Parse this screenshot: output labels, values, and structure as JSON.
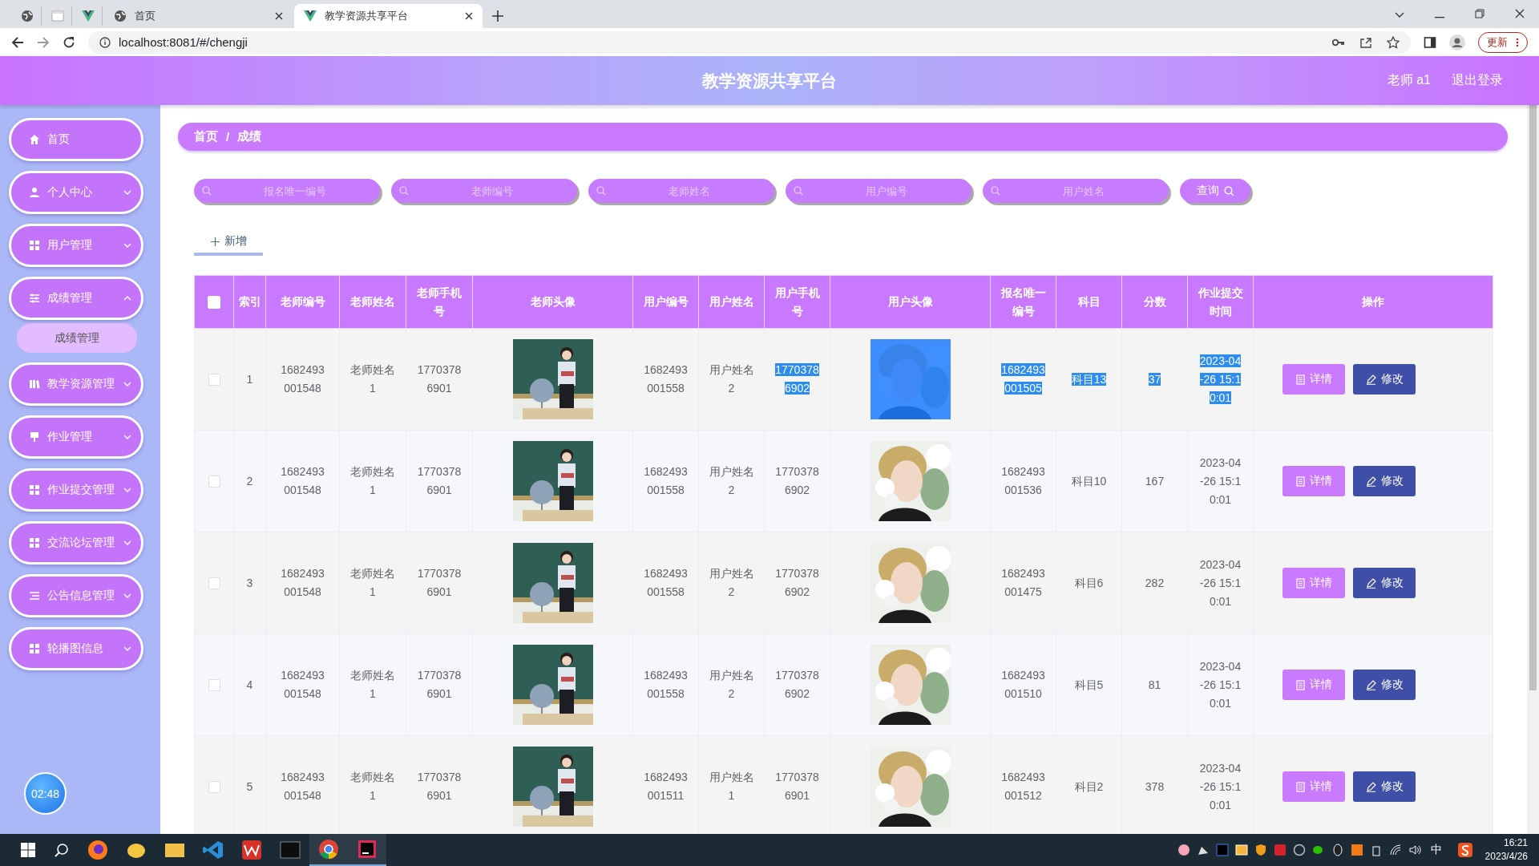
{
  "browser": {
    "tabs": [
      {
        "kind": "pinned"
      },
      {
        "kind": "pinned"
      },
      {
        "kind": "pinned"
      },
      {
        "kind": "page",
        "label": "首页",
        "selected": false
      },
      {
        "kind": "page",
        "label": "教学资源共享平台",
        "selected": true
      }
    ],
    "address": "localhost:8081/#/chengji",
    "update_button": "更新"
  },
  "header": {
    "title": "教学资源共享平台",
    "user": "老师 a1",
    "logout": "退出登录"
  },
  "sidebar": {
    "items": [
      {
        "kind": "link",
        "label": "首页"
      },
      {
        "kind": "menu",
        "label": "个人中心",
        "expanded": false
      },
      {
        "kind": "menu",
        "label": "用户管理",
        "expanded": false
      },
      {
        "kind": "menu",
        "label": "成绩管理",
        "expanded": true,
        "children": [
          {
            "label": "成绩管理",
            "selected": true
          }
        ]
      },
      {
        "kind": "menu",
        "label": "教学资源管理",
        "expanded": false
      },
      {
        "kind": "menu",
        "label": "作业管理",
        "expanded": false
      },
      {
        "kind": "menu",
        "label": "作业提交管理",
        "expanded": false
      },
      {
        "kind": "menu",
        "label": "交流论坛管理",
        "expanded": false
      },
      {
        "kind": "menu",
        "label": "公告信息管理",
        "expanded": false
      },
      {
        "kind": "menu",
        "label": "轮播图信息",
        "expanded": false
      }
    ],
    "clock": "02:48"
  },
  "breadcrumb": {
    "items": [
      "首页",
      "成绩"
    ],
    "separator": "/"
  },
  "search": {
    "fields": [
      {
        "placeholder": "报名唯一编号"
      },
      {
        "placeholder": "老师编号"
      },
      {
        "placeholder": "老师姓名"
      },
      {
        "placeholder": "用户编号"
      },
      {
        "placeholder": "用户姓名"
      }
    ],
    "button": "查询"
  },
  "add_tab": {
    "label": "新增",
    "selected": true
  },
  "table": {
    "header_checked": false,
    "columns": [
      "索引",
      "老师编号",
      "老师姓名",
      "老师手机号",
      "老师头像",
      "用户编号",
      "用户姓名",
      "用户手机号",
      "用户头像",
      "报名唯一编号",
      "科目",
      "分数",
      "作业提交时间",
      "操作"
    ],
    "rows": [
      {
        "checked": false,
        "text_selected": true,
        "cells": [
          "1",
          "1682493001548",
          "老师姓名1",
          "17703786901",
          {
            "kind": "picture"
          },
          "1682493001558",
          "用户姓名2",
          "17703786902",
          {
            "kind": "picture"
          },
          "1682493001505",
          "科目13",
          "37",
          "2023-04-26 15:10:01"
        ],
        "actions": [
          {
            "kind": "detail",
            "label": "详情"
          },
          {
            "kind": "edit",
            "label": "修改"
          }
        ]
      },
      {
        "checked": false,
        "text_selected": false,
        "cells": [
          "2",
          "1682493001548",
          "老师姓名1",
          "17703786901",
          {
            "kind": "picture"
          },
          "1682493001558",
          "用户姓名2",
          "17703786902",
          {
            "kind": "picture"
          },
          "1682493001536",
          "科目10",
          "167",
          "2023-04-26 15:10:01"
        ],
        "actions": [
          {
            "kind": "detail",
            "label": "详情"
          },
          {
            "kind": "edit",
            "label": "修改"
          }
        ]
      },
      {
        "checked": false,
        "text_selected": false,
        "cells": [
          "3",
          "1682493001548",
          "老师姓名1",
          "17703786901",
          {
            "kind": "picture"
          },
          "1682493001558",
          "用户姓名2",
          "17703786902",
          {
            "kind": "picture"
          },
          "1682493001475",
          "科目6",
          "282",
          "2023-04-26 15:10:01"
        ],
        "actions": [
          {
            "kind": "detail",
            "label": "详情"
          },
          {
            "kind": "edit",
            "label": "修改"
          }
        ]
      },
      {
        "checked": false,
        "text_selected": false,
        "cells": [
          "4",
          "1682493001548",
          "老师姓名1",
          "17703786901",
          {
            "kind": "picture"
          },
          "1682493001558",
          "用户姓名2",
          "17703786902",
          {
            "kind": "picture"
          },
          "1682493001510",
          "科目5",
          "81",
          "2023-04-26 15:10:01"
        ],
        "actions": [
          {
            "kind": "detail",
            "label": "详情"
          },
          {
            "kind": "edit",
            "label": "修改"
          }
        ]
      },
      {
        "checked": false,
        "text_selected": false,
        "cells": [
          "5",
          "1682493001548",
          "老师姓名1",
          "17703786901",
          {
            "kind": "picture"
          },
          "1682493001511",
          "用户姓名1",
          "17703786901",
          {
            "kind": "picture"
          },
          "1682493001512",
          "科目2",
          "378",
          "2023-04-26 15:10:01"
        ],
        "actions": [
          {
            "kind": "detail",
            "label": "详情"
          },
          {
            "kind": "edit",
            "label": "修改"
          }
        ]
      }
    ]
  },
  "taskbar": {
    "ime": "中",
    "time": "16:21",
    "date": "2023/4/26"
  }
}
